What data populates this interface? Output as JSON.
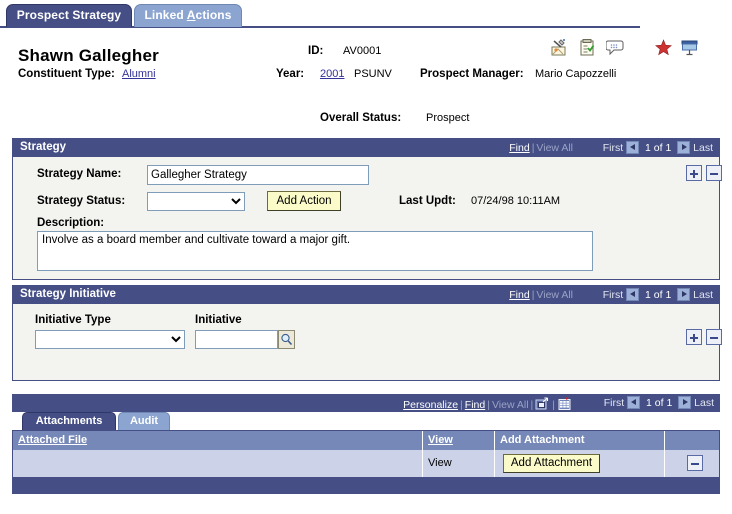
{
  "tabs": [
    {
      "label": "Prospect Strategy",
      "active": true
    },
    {
      "label": "Linked Actions",
      "active": false,
      "accel": "A"
    }
  ],
  "header": {
    "person_name": "Shawn Gallegher",
    "constituent_type_label": "Constituent Type:",
    "constituent_type_value": "Alumni",
    "id_label": "ID:",
    "id_value": "AV0001",
    "year_label": "Year:",
    "year_value": "2001",
    "institution": "PSUNV",
    "prospect_manager_label": "Prospect Manager:",
    "prospect_manager_value": "Mario Capozzelli",
    "overall_status_label": "Overall Status:",
    "overall_status_value": "Prospect",
    "icons": [
      "contact-notes-icon",
      "checklist-icon",
      "comment-bubble-icon",
      "favorite-star-icon",
      "presentation-screen-icon"
    ]
  },
  "strategy": {
    "title": "Strategy",
    "find_label": "Find",
    "view_all_label": "View All",
    "first_label": "First",
    "count_label": "1 of 1",
    "last_label": "Last",
    "name_label": "Strategy Name:",
    "name_value": "Gallegher Strategy",
    "status_label": "Strategy Status:",
    "status_value": "",
    "status_options": [
      ""
    ],
    "add_action_label": "Add Action",
    "last_updt_label": "Last Updt:",
    "last_updt_value": "07/24/98 10:11AM",
    "description_label": "Description:",
    "description_value": "Involve as a board member and cultivate toward a major gift.",
    "add_row_label": "+",
    "delete_row_label": "-"
  },
  "initiative": {
    "title": "Strategy Initiative",
    "find_label": "Find",
    "view_all_label": "View All",
    "first_label": "First",
    "count_label": "1 of 1",
    "last_label": "Last",
    "type_label": "Initiative Type",
    "type_value": "",
    "type_options": [
      ""
    ],
    "initiative_label": "Initiative",
    "initiative_value": "",
    "lookup_icon": "magnifier-lookup-icon"
  },
  "attachments": {
    "toolbar": {
      "personalize_label": "Personalize",
      "find_label": "Find",
      "view_all_label": "View All",
      "expand_icon": "expand-window-icon",
      "download_icon": "download-spreadsheet-icon",
      "first_label": "First",
      "count_label": "1 of 1",
      "last_label": "Last"
    },
    "tabs": [
      {
        "label": "Attachments",
        "active": true
      },
      {
        "label": "Audit",
        "active": false
      }
    ],
    "columns": [
      "Attached File",
      "View",
      "Add Attachment",
      ""
    ],
    "rows": [
      {
        "attached_file": "",
        "view": "View",
        "add_attachment_button": "Add Attachment",
        "delete_label": "-"
      }
    ]
  },
  "colors": {
    "header_blue": "#454f86",
    "tab_inactive_blue": "#8ba5d0",
    "panel_bg": "#f3f3ef",
    "grid_header_blue": "#7688b8",
    "grid_row_blue": "#ccd3e8",
    "button_yellow": "#fbfbca",
    "link_blue": "#333399",
    "star_red": "#cc3333"
  }
}
